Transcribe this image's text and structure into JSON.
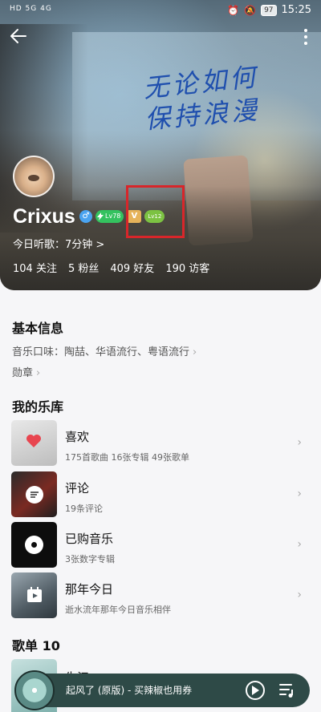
{
  "status_bar": {
    "left_indicators": "HD 5G 4G",
    "battery": "97",
    "time": "15:25"
  },
  "hero": {
    "graffiti_line1": "无论如何",
    "graffiti_line2": "保持浪漫"
  },
  "profile": {
    "username": "Crixus",
    "gender_badge": "♂",
    "level_badge": "Lv78",
    "vip_badge": "V",
    "vip_level_badge": "Lv12",
    "listen_today": "今日听歌：7分钟 >",
    "stats": [
      "104 关注",
      "5 粉丝",
      "409 好友",
      "190 访客"
    ]
  },
  "basic_info": {
    "title": "基本信息",
    "music_taste": "音乐口味：陶喆、华语流行、粤语流行",
    "medals": "勋章"
  },
  "library": {
    "title": "我的乐库",
    "items": [
      {
        "title": "喜欢",
        "subtitle": "175首歌曲 16张专辑 49张歌单"
      },
      {
        "title": "评论",
        "subtitle": "19条评论"
      },
      {
        "title": "已购音乐",
        "subtitle": "3张数字专辑"
      },
      {
        "title": "那年今日",
        "subtitle": "逝水流年那年今日音乐相伴"
      }
    ]
  },
  "playlists": {
    "title": "歌单 10",
    "first_title_peek": "朱江"
  },
  "player": {
    "now_playing": "起风了 (原版) - 买辣椒也用券"
  },
  "colors": {
    "player_bg": "#2e4a47",
    "highlight_box": "#d8262a",
    "level_green": "#34c25f",
    "vip_gold": "#e6b35a"
  },
  "icons": [
    "back-arrow-icon",
    "more-vertical-icon",
    "chevron-right-icon",
    "heart-icon",
    "comment-icon",
    "disc-icon",
    "calendar-icon",
    "play-icon",
    "playlist-icon"
  ]
}
